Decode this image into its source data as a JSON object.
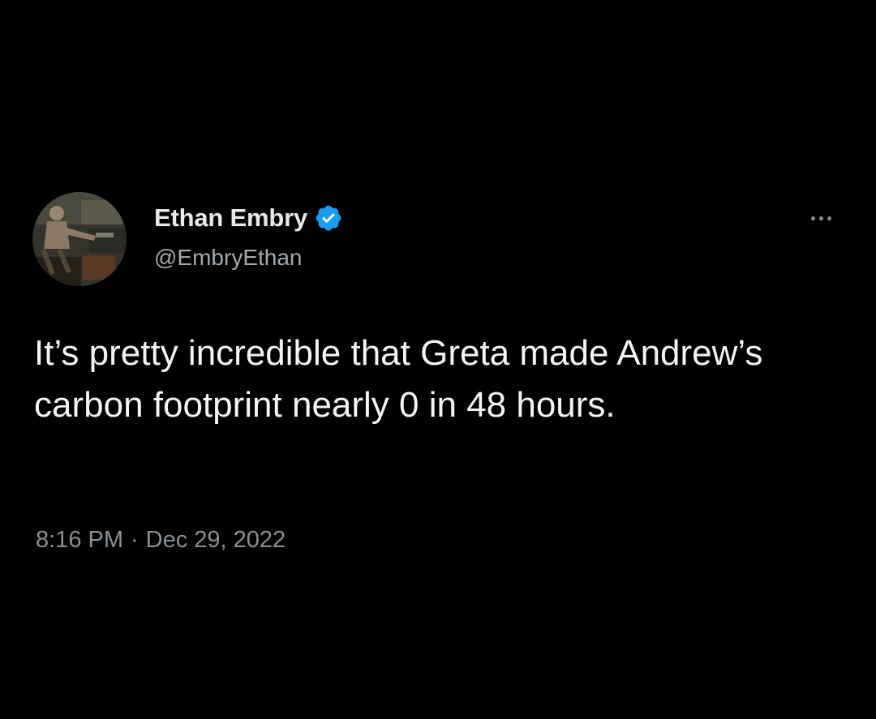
{
  "tweet": {
    "author": {
      "display_name": "Ethan Embry",
      "handle": "@EmbryEthan",
      "verified": true,
      "verified_icon": "verified-badge-icon",
      "verified_color": "#1d9bf0"
    },
    "more_icon": "more-horizontal-icon",
    "text": "It’s pretty incredible that Greta made Andrew’s carbon footprint nearly 0 in 48 hours.",
    "time": "8:16 PM",
    "separator": "·",
    "date": "Dec 29, 2022"
  },
  "colors": {
    "background": "#000000",
    "primary_text": "#e7e9ea",
    "secondary_text": "#8b9094"
  }
}
